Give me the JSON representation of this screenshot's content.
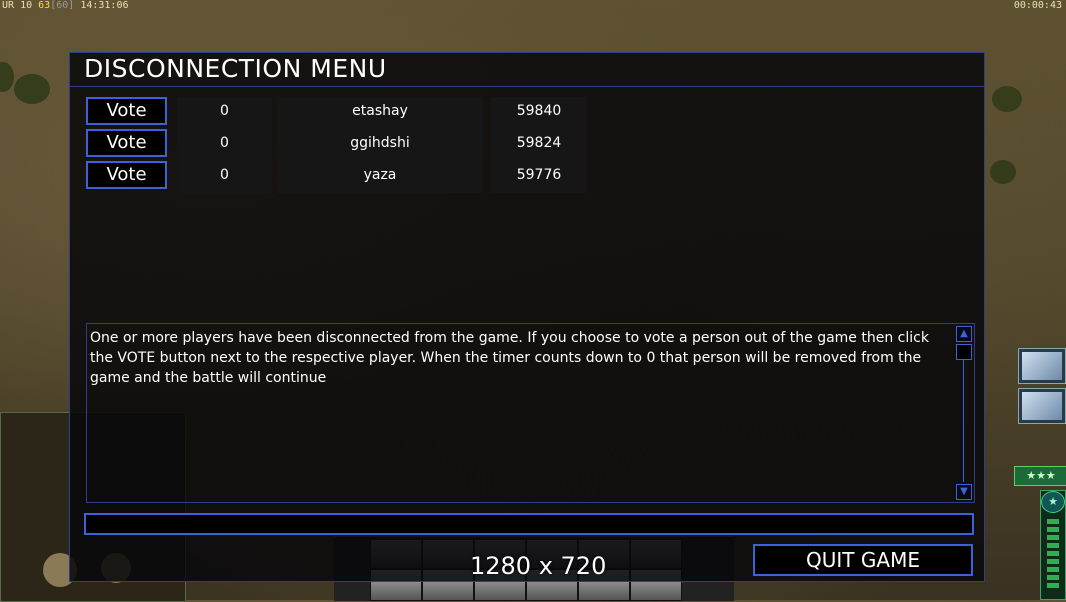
{
  "hud": {
    "top_left_prefix": "UR",
    "top_left_a": "10",
    "top_left_b": "63",
    "top_left_c": "[60]",
    "top_left_time": "14:31:06",
    "top_right_time": "00:00:43"
  },
  "dialog": {
    "title": "DISCONNECTION MENU",
    "players": [
      {
        "vote_label": "Vote",
        "count": "0",
        "name": "etashay",
        "ping": "59840"
      },
      {
        "vote_label": "Vote",
        "count": "0",
        "name": "ggihdshi",
        "ping": "59824"
      },
      {
        "vote_label": "Vote",
        "count": "0",
        "name": "yaza",
        "ping": "59776"
      }
    ],
    "message": "One or more players have been disconnected from the game. If you choose to vote a person out of the game then click the VOTE button next to the respective player. When the timer counts down to 0 that person will be removed from the game and the battle will continue",
    "chat_value": "",
    "quit_label": "QUIT GAME"
  },
  "overlay": {
    "resolution_label": "1280 x 720"
  },
  "colors": {
    "accent_blue": "#3b62d8",
    "frame_blue": "#2b3f8a"
  }
}
